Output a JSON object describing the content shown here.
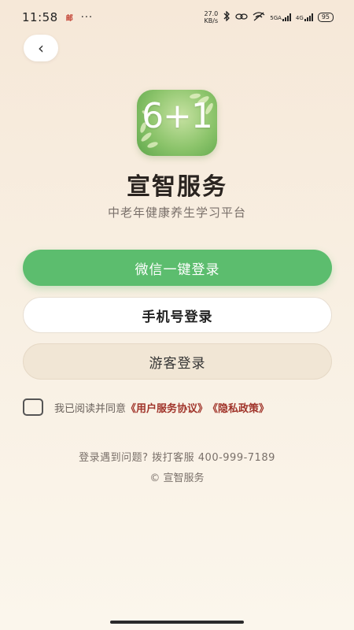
{
  "status_bar": {
    "time": "11:58",
    "mail_icon_text": "邮",
    "more": "···",
    "net_speed_value": "27.0",
    "net_speed_unit": "KB/s",
    "signal_label_1": "5GA",
    "signal_label_2": "4G",
    "battery": "95"
  },
  "nav": {
    "back_label": "‹"
  },
  "logo": {
    "text": "6+1"
  },
  "app": {
    "title": "宣智服务",
    "subtitle": "中老年健康养生学习平台"
  },
  "buttons": {
    "wechat_login": "微信一键登录",
    "phone_login": "手机号登录",
    "guest_login": "游客登录"
  },
  "agreement": {
    "prefix": "我已阅读并同意",
    "user_agreement": "《用户服务协议》",
    "privacy_policy": "《隐私政策》"
  },
  "footer": {
    "help": "登录遇到问题? 拨打客服 400-999-7189",
    "copyright": "© 宣智服务"
  },
  "colors": {
    "primary_green": "#5cbd6e",
    "link_red": "#a0342a",
    "background": "#f6e8d8"
  }
}
